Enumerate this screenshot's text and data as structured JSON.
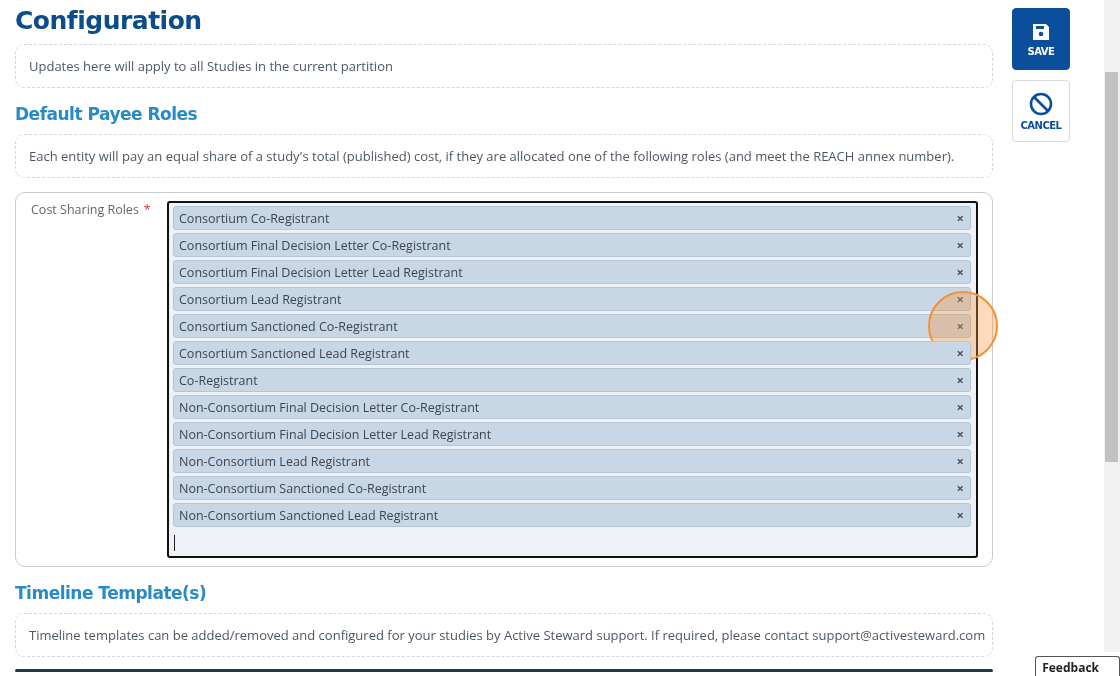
{
  "page_title": "Configuration",
  "notice": "Updates here will apply to all Studies in the current partition",
  "payee_roles": {
    "heading": "Default Payee Roles",
    "description": "Each entity will pay an equal share of a study's total (published) cost, if they are allocated one of the following roles (and meet the REACH annex number).",
    "field": {
      "label": "Cost Sharing Roles",
      "required": true,
      "required_mark": "*",
      "tags": [
        {
          "text": "Consortium Co-Registrant",
          "remove": "×",
          "highlighted": false
        },
        {
          "text": "Consortium Final Decision Letter Co-Registrant",
          "remove": "×",
          "highlighted": false
        },
        {
          "text": "Consortium Final Decision Letter Lead Registrant",
          "remove": "×",
          "highlighted": false
        },
        {
          "text": "Consortium Lead Registrant",
          "remove": "×",
          "highlighted": false
        },
        {
          "text": "Consortium Sanctioned Co-Registrant",
          "remove": "×",
          "highlighted": true
        },
        {
          "text": "Consortium Sanctioned Lead Registrant",
          "remove": "×",
          "highlighted": false
        },
        {
          "text": "Co-Registrant",
          "remove": "×",
          "highlighted": false
        },
        {
          "text": "Non-Consortium Final Decision Letter Co-Registrant",
          "remove": "×",
          "highlighted": false
        },
        {
          "text": "Non-Consortium Final Decision Letter Lead Registrant",
          "remove": "×",
          "highlighted": false
        },
        {
          "text": "Non-Consortium Lead Registrant",
          "remove": "×",
          "highlighted": false
        },
        {
          "text": "Non-Consortium Sanctioned Co-Registrant",
          "remove": "×",
          "highlighted": false
        },
        {
          "text": "Non-Consortium Sanctioned Lead Registrant",
          "remove": "×",
          "highlighted": false
        }
      ]
    }
  },
  "timeline": {
    "heading": "Timeline Template(s)",
    "description": "Timeline templates can be added/removed and configured for your studies by Active Steward support. If required, please contact support@activesteward.com"
  },
  "actions": [
    {
      "kind": "save",
      "label": "SAVE"
    },
    {
      "kind": "cancel",
      "label": "CANCEL"
    }
  ],
  "feedback_tab": "Feedback"
}
